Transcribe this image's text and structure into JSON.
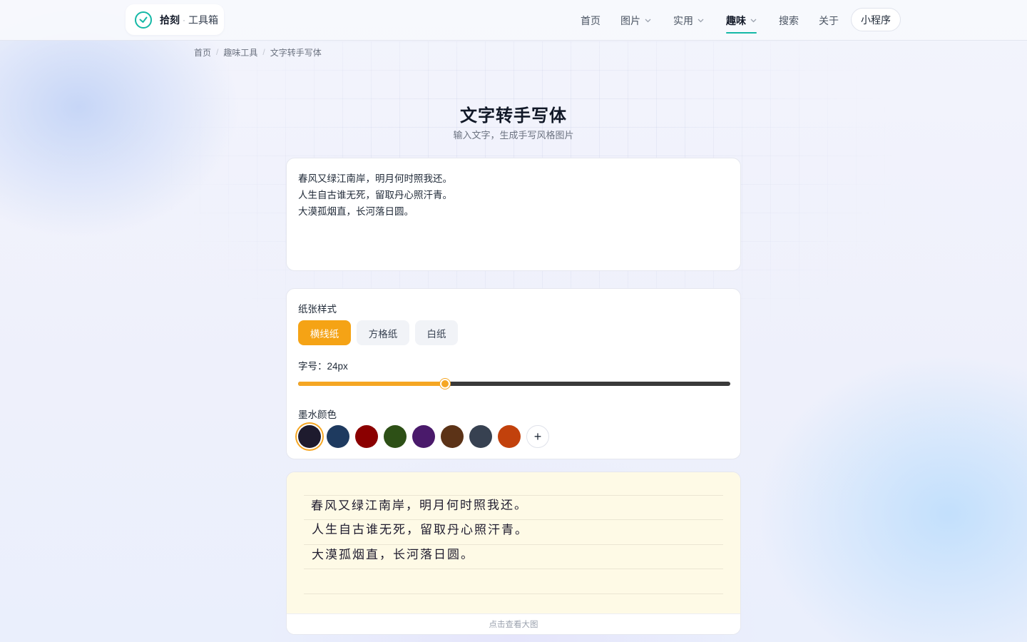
{
  "header": {
    "brand_name": "拾刻",
    "brand_sub": "工具箱",
    "nav": [
      {
        "label": "首页",
        "has_dropdown": false,
        "active": false
      },
      {
        "label": "图片",
        "has_dropdown": true,
        "active": false
      },
      {
        "label": "实用",
        "has_dropdown": true,
        "active": false
      },
      {
        "label": "趣味",
        "has_dropdown": true,
        "active": true
      },
      {
        "label": "搜索",
        "has_dropdown": false,
        "active": false
      },
      {
        "label": "关于",
        "has_dropdown": false,
        "active": false
      }
    ],
    "mini_program": "小程序",
    "accent_color": "#14b8a6"
  },
  "breadcrumb": [
    "首页",
    "趣味工具",
    "文字转手写体"
  ],
  "page": {
    "title": "文字转手写体",
    "subtitle": "输入文字，生成手写风格图片"
  },
  "input": {
    "value": "春风又绿江南岸，明月何时照我还。\n人生自古谁无死，留取丹心照汗青。\n大漠孤烟直，长河落日圆。"
  },
  "settings": {
    "paper_label": "纸张样式",
    "paper_options": [
      "横线纸",
      "方格纸",
      "白纸"
    ],
    "paper_selected": "横线纸",
    "font_size_label": "字号：24px",
    "font_size_fraction": 0.34,
    "ink_label": "墨水颜色",
    "ink_colors": [
      "#1e1b2e",
      "#1e3a5f",
      "#8b0000",
      "#2d5016",
      "#4a1a6b",
      "#5c3317",
      "#374151",
      "#c2410c"
    ],
    "ink_selected": "#1e1b2e",
    "add_color": "+",
    "accent_color": "#f5a623"
  },
  "preview": {
    "lines": [
      "春风又绿江南岸，明月何时照我还。",
      "人生自古谁无死，留取丹心照汗青。",
      "大漠孤烟直，长河落日圆。"
    ],
    "footer": "点击查看大图",
    "paper_color": "#fefae6"
  }
}
